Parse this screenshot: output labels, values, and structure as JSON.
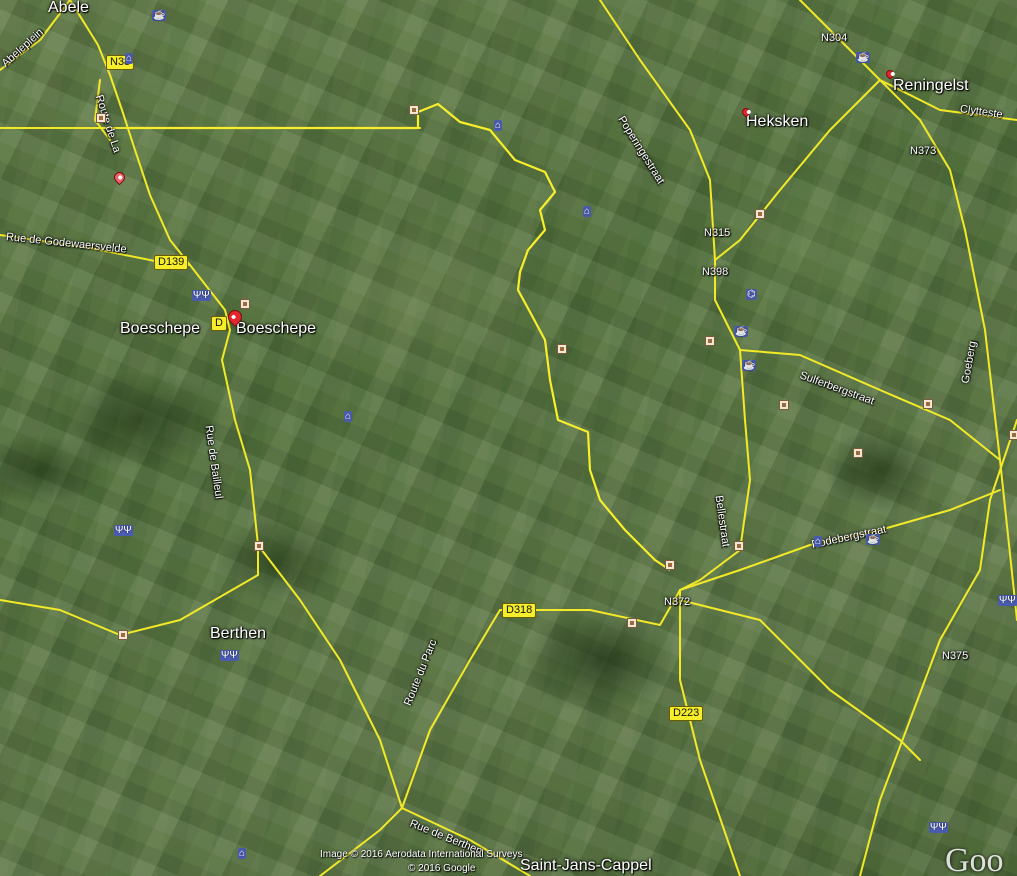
{
  "places": {
    "abele": "Abele",
    "reningelst": "Reningelst",
    "heksken": "Heksken",
    "boeschepe_left": "Boeschepe",
    "boeschepe_right": "Boeschepe",
    "berthen": "Berthen",
    "saint_jans_cappel": "Saint-Jans-Cappel"
  },
  "streets": {
    "abeleplein": "Abeleplein",
    "route_de_la": "Route de La",
    "rue_godewaersvelde": "Rue de Godewaersvelde",
    "rue_de_bailleul": "Rue de Bailleul",
    "route_du_parc": "Route du Parc",
    "rue_de_berthen": "Rue de Berthen",
    "poperingestraat": "Poperingestraat",
    "bellestraat": "Bellestraat",
    "sulferbergstraat": "Sulferbergstraat",
    "rodebergstraat": "Rodebergstraat",
    "clyttestr": "Clytteste",
    "goeberg": "Goeberg"
  },
  "route_labels": {
    "n38": "N38",
    "n304": "N304",
    "n373": "N373",
    "n315": "N315",
    "n398": "N398",
    "n372": "N372",
    "n375": "N375"
  },
  "shields": {
    "d139": "D139",
    "d_small": "D",
    "d318": "D318",
    "d223": "D223"
  },
  "attribution": {
    "imagery": "Image © 2016 Aerodata International Surveys",
    "copyright": "© 2016 Google"
  },
  "logo": "Goo",
  "colors": {
    "road": "#f2ea28",
    "border": "#f7ef2b",
    "label": "#ffffff"
  }
}
